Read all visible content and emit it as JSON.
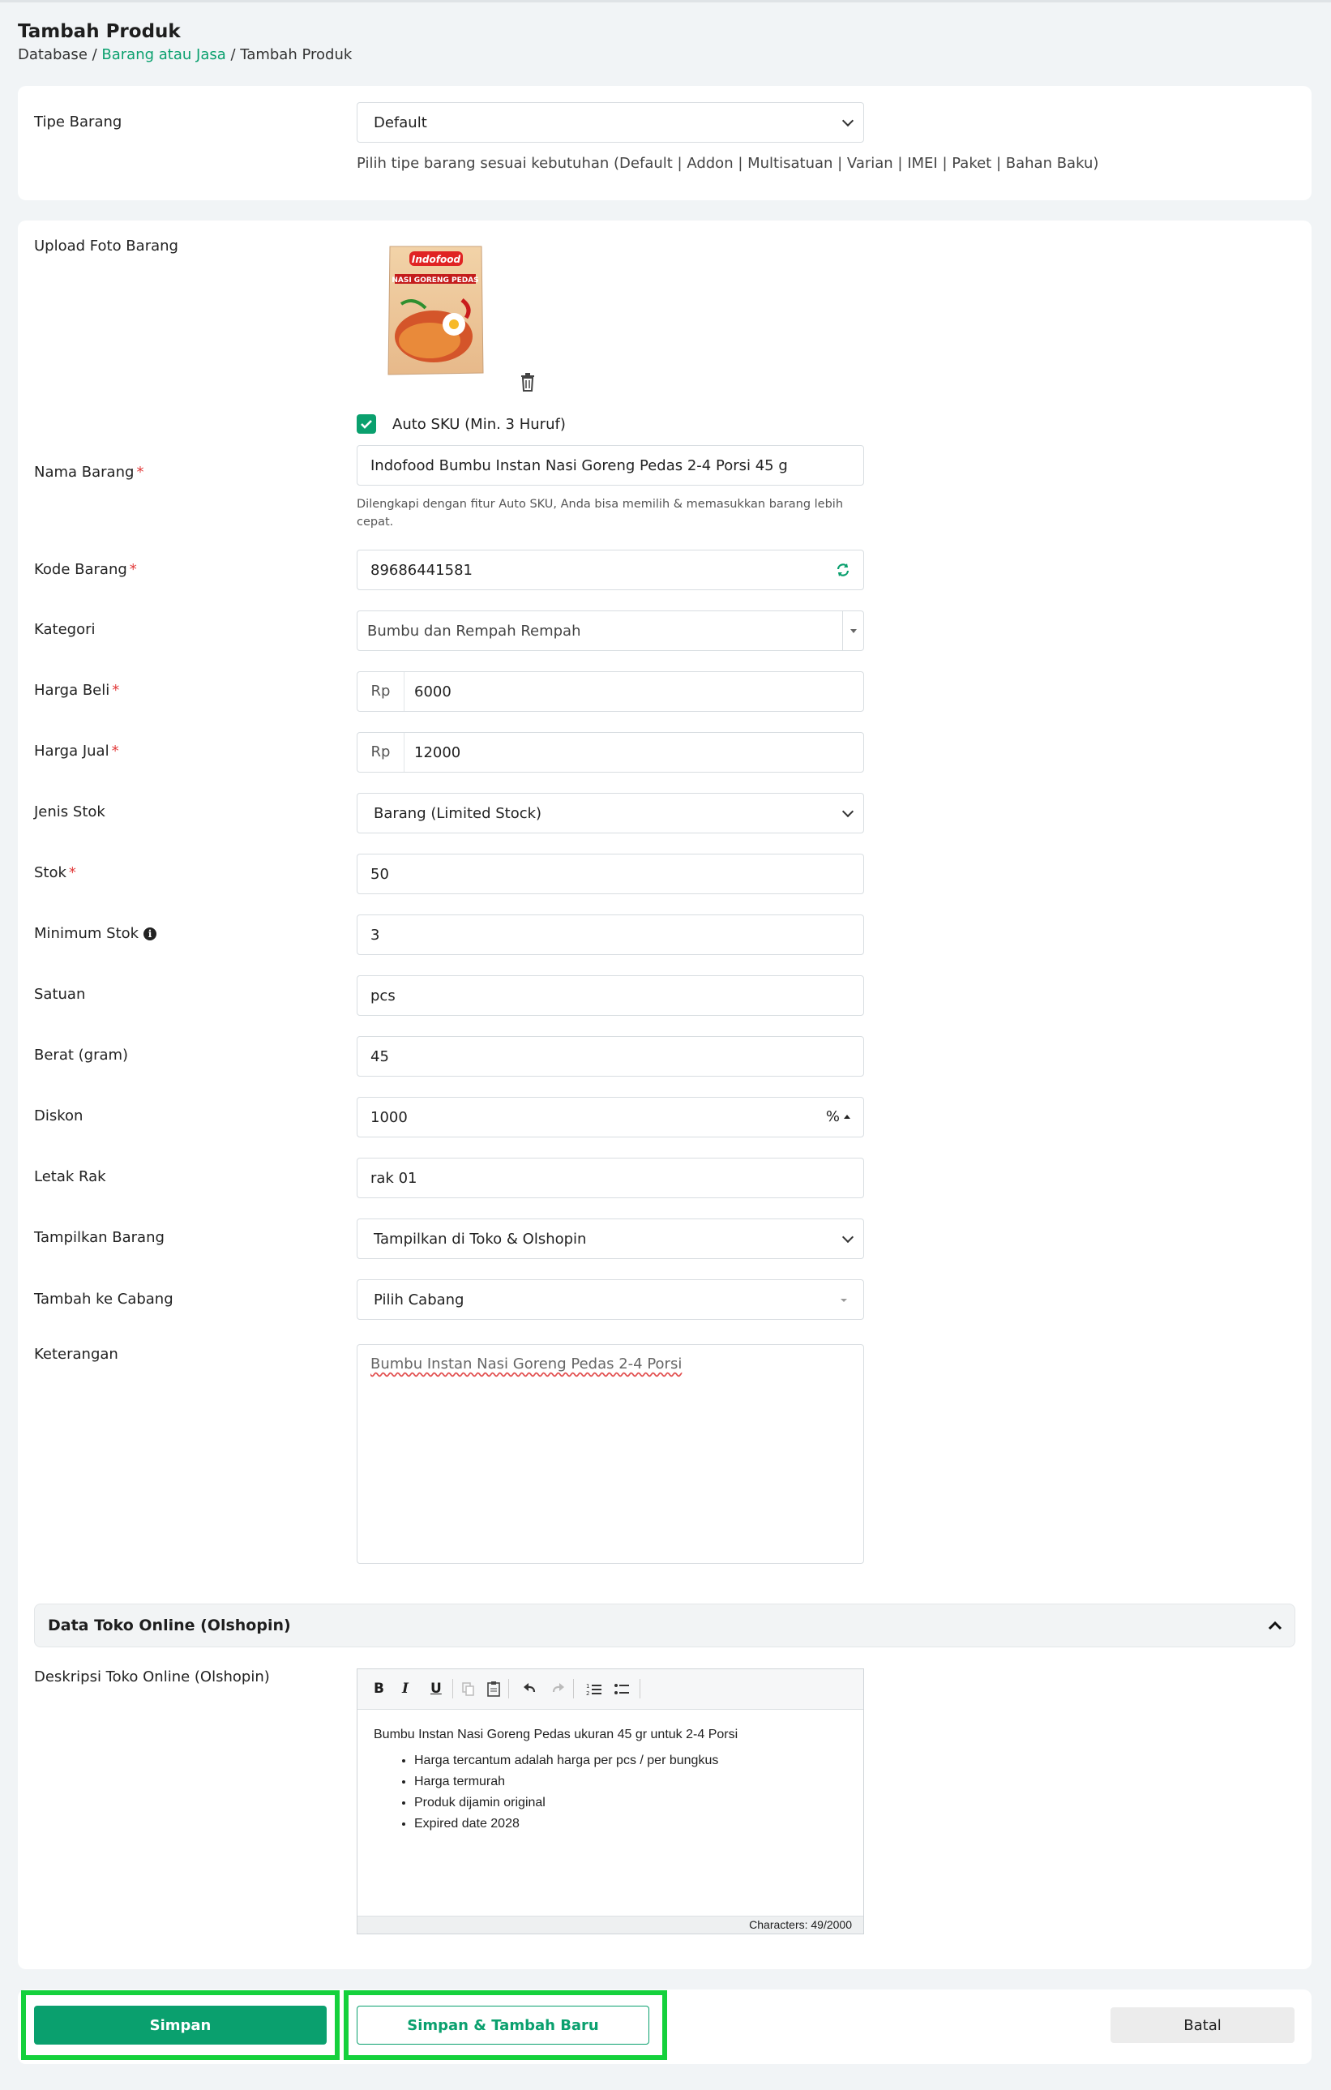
{
  "header": {
    "title": "Tambah Produk",
    "breadcrumb": [
      "Database",
      "Barang atau Jasa",
      "Tambah Produk"
    ]
  },
  "tipe_barang": {
    "label": "Tipe Barang",
    "value": "Default",
    "hint": "Pilih tipe barang sesuai kebutuhan (Default | Addon | Multisatuan | Varian | IMEI | Paket | Bahan Baku)"
  },
  "upload": {
    "label": "Upload Foto Barang",
    "image_brand": "Indofood",
    "image_product": "NASI GORENG PEDAS"
  },
  "auto_sku": {
    "label": "Auto SKU (Min. 3 Huruf)",
    "checked": true
  },
  "form": {
    "nama_barang": {
      "label": "Nama Barang",
      "value": "Indofood Bumbu Instan Nasi Goreng Pedas 2-4 Porsi 45 g",
      "hint": "Dilengkapi dengan fitur Auto SKU, Anda bisa memilih & memasukkan barang lebih cepat."
    },
    "kode_barang": {
      "label": "Kode Barang",
      "value": "89686441581"
    },
    "kategori": {
      "label": "Kategori",
      "value": "Bumbu dan Rempah Rempah"
    },
    "harga_beli": {
      "label": "Harga Beli",
      "prefix": "Rp",
      "value": "6000"
    },
    "harga_jual": {
      "label": "Harga Jual",
      "prefix": "Rp",
      "value": "12000"
    },
    "jenis_stok": {
      "label": "Jenis Stok",
      "value": "Barang (Limited Stock)"
    },
    "stok": {
      "label": "Stok",
      "value": "50"
    },
    "minimum_stok": {
      "label": "Minimum Stok",
      "value": "3"
    },
    "satuan": {
      "label": "Satuan",
      "value": "pcs"
    },
    "berat": {
      "label": "Berat (gram)",
      "value": "45"
    },
    "diskon": {
      "label": "Diskon",
      "value": "1000",
      "unit": "%"
    },
    "letak_rak": {
      "label": "Letak Rak",
      "value": "rak 01"
    },
    "tampilkan_barang": {
      "label": "Tampilkan Barang",
      "value": "Tampilkan di Toko & Olshopin"
    },
    "tambah_cabang": {
      "label": "Tambah ke Cabang",
      "value": "Pilih Cabang"
    },
    "keterangan": {
      "label": "Keterangan",
      "value": "Bumbu Instan Nasi Goreng Pedas 2-4 Porsi"
    }
  },
  "olshopin": {
    "section_title": "Data Toko Online (Olshopin)",
    "desc_label": "Deskripsi Toko Online (Olshopin)",
    "editor_text": "Bumbu Instan Nasi Goreng Pedas ukuran 45 gr untuk 2-4 Porsi",
    "editor_bullets": [
      "Harga tercantum adalah harga per pcs / per bungkus",
      "Harga termurah",
      "Produk dijamin original",
      "Expired date 2028"
    ],
    "char_count": "Characters: 49/2000"
  },
  "actions": {
    "save": "Simpan",
    "save_new": "Simpan & Tambah Baru",
    "cancel": "Batal"
  },
  "colors": {
    "accent": "#0aa06e",
    "highlight": "#15d13c",
    "required": "#e23b3b"
  }
}
